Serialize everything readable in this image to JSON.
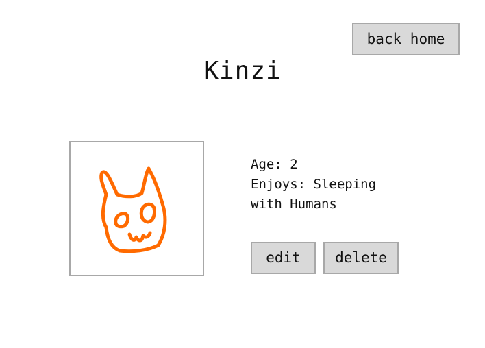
{
  "nav": {
    "back_home_label": "back home"
  },
  "pet": {
    "name": "Kinzi",
    "age_label": "Age:",
    "age_value": "2",
    "enjoys_label": "Enjoys:",
    "enjoys_value": "Sleeping with Humans",
    "drawing_color": "#ff6a00",
    "image_icon": "cat-drawing-icon"
  },
  "actions": {
    "edit_label": "edit",
    "delete_label": "delete"
  }
}
